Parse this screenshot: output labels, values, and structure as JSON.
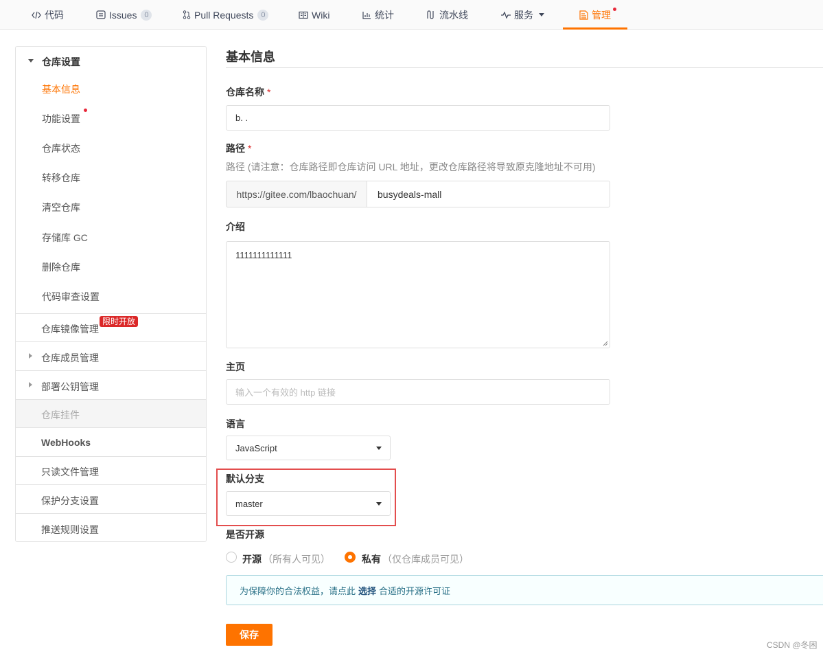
{
  "tabs": [
    {
      "label": "代码",
      "icon": "code-icon"
    },
    {
      "label": "Issues",
      "icon": "issues-icon",
      "count": "0"
    },
    {
      "label": "Pull Requests",
      "icon": "pull-request-icon",
      "count": "0"
    },
    {
      "label": "Wiki",
      "icon": "wiki-icon"
    },
    {
      "label": "统计",
      "icon": "stats-icon"
    },
    {
      "label": "流水线",
      "icon": "pipeline-icon"
    },
    {
      "label": "服务",
      "icon": "service-icon"
    },
    {
      "label": "管理",
      "icon": "manage-icon",
      "active": true
    }
  ],
  "sidebar": {
    "group_title": "仓库设置",
    "items": [
      "基本信息",
      "功能设置",
      "仓库状态",
      "转移仓库",
      "清空仓库",
      "存储库 GC",
      "删除仓库",
      "代码审查设置"
    ],
    "sections": [
      {
        "label": "仓库镜像管理",
        "badge": "限时开放"
      },
      {
        "label": "仓库成员管理"
      },
      {
        "label": "部署公钥管理"
      },
      {
        "label": "仓库挂件",
        "disabled": true
      },
      {
        "label": "WebHooks"
      },
      {
        "label": "只读文件管理"
      },
      {
        "label": "保护分支设置"
      },
      {
        "label": "推送规则设置"
      }
    ]
  },
  "main": {
    "title": "基本信息",
    "repo_name_label": "仓库名称",
    "repo_name_value": "b. .",
    "required_mark": "*",
    "path_label": "路径",
    "path_hint": "路径 (请注意：仓库路径即仓库访问 URL 地址，更改仓库路径将导致原克隆地址不可用)",
    "path_prefix": "https://gitee.com/lbaochuan/",
    "path_value": "busydeals-mall",
    "intro_label": "介绍",
    "intro_value": "1111111111111",
    "homepage_label": "主页",
    "homepage_placeholder": "输入一个有效的 http 链接",
    "language_label": "语言",
    "language_value": "JavaScript",
    "default_branch_label": "默认分支",
    "default_branch_value": "master",
    "opensource_label": "是否开源",
    "radio_open_label": "开源",
    "radio_open_hint": "（所有人可见）",
    "radio_private_label": "私有",
    "radio_private_hint": "（仅仓库成员可见）",
    "license_text_before": "为保障你的合法权益，请点此",
    "license_link": "选择",
    "license_text_after": "合适的开源许可证",
    "save_label": "保存"
  },
  "watermark": "CSDN @冬困",
  "colors": {
    "accent": "#fe7300",
    "badge": "#db2828",
    "highlight": "#e34d4d"
  }
}
